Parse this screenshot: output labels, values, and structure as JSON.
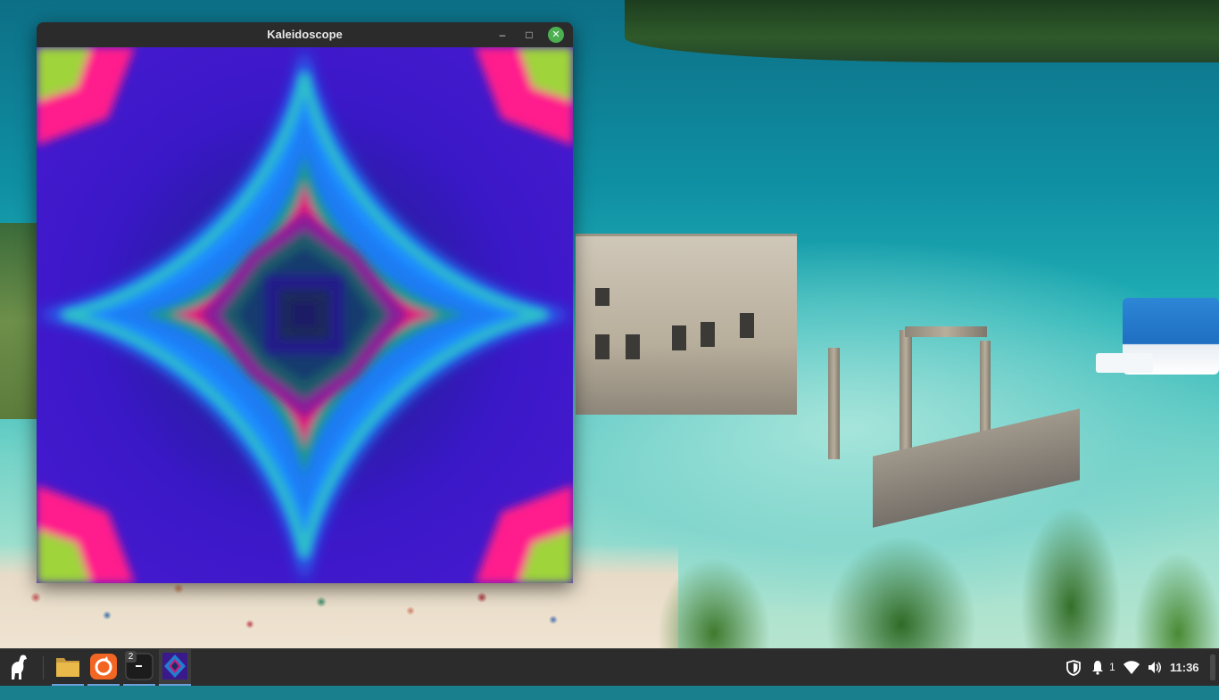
{
  "window": {
    "title": "Kaleidoscope",
    "buttons": {
      "minimize": "–",
      "maximize": "□",
      "close": "✕"
    }
  },
  "taskbar": {
    "menu_icon": "dinosaur-logo-icon",
    "apps": [
      {
        "name": "files",
        "icon": "folder-icon"
      },
      {
        "name": "firefox",
        "icon": "firefox-icon"
      },
      {
        "name": "terminal",
        "icon": "terminal-icon",
        "badge": "2"
      },
      {
        "name": "kaleidoscope",
        "icon": "kaleidoscope-icon",
        "active": true
      }
    ],
    "tray": {
      "shield_icon": "shield-icon",
      "notification_icon": "bell-icon",
      "notification_count": "1",
      "wifi_icon": "wifi-icon",
      "volume_icon": "volume-icon",
      "clock": "11:36"
    }
  },
  "colors": {
    "accent": "#4caf50",
    "taskbar_bg": "#2c2c2c",
    "titlebar_bg": "#2b2b2b",
    "active_underline": "#6ca0d8"
  }
}
